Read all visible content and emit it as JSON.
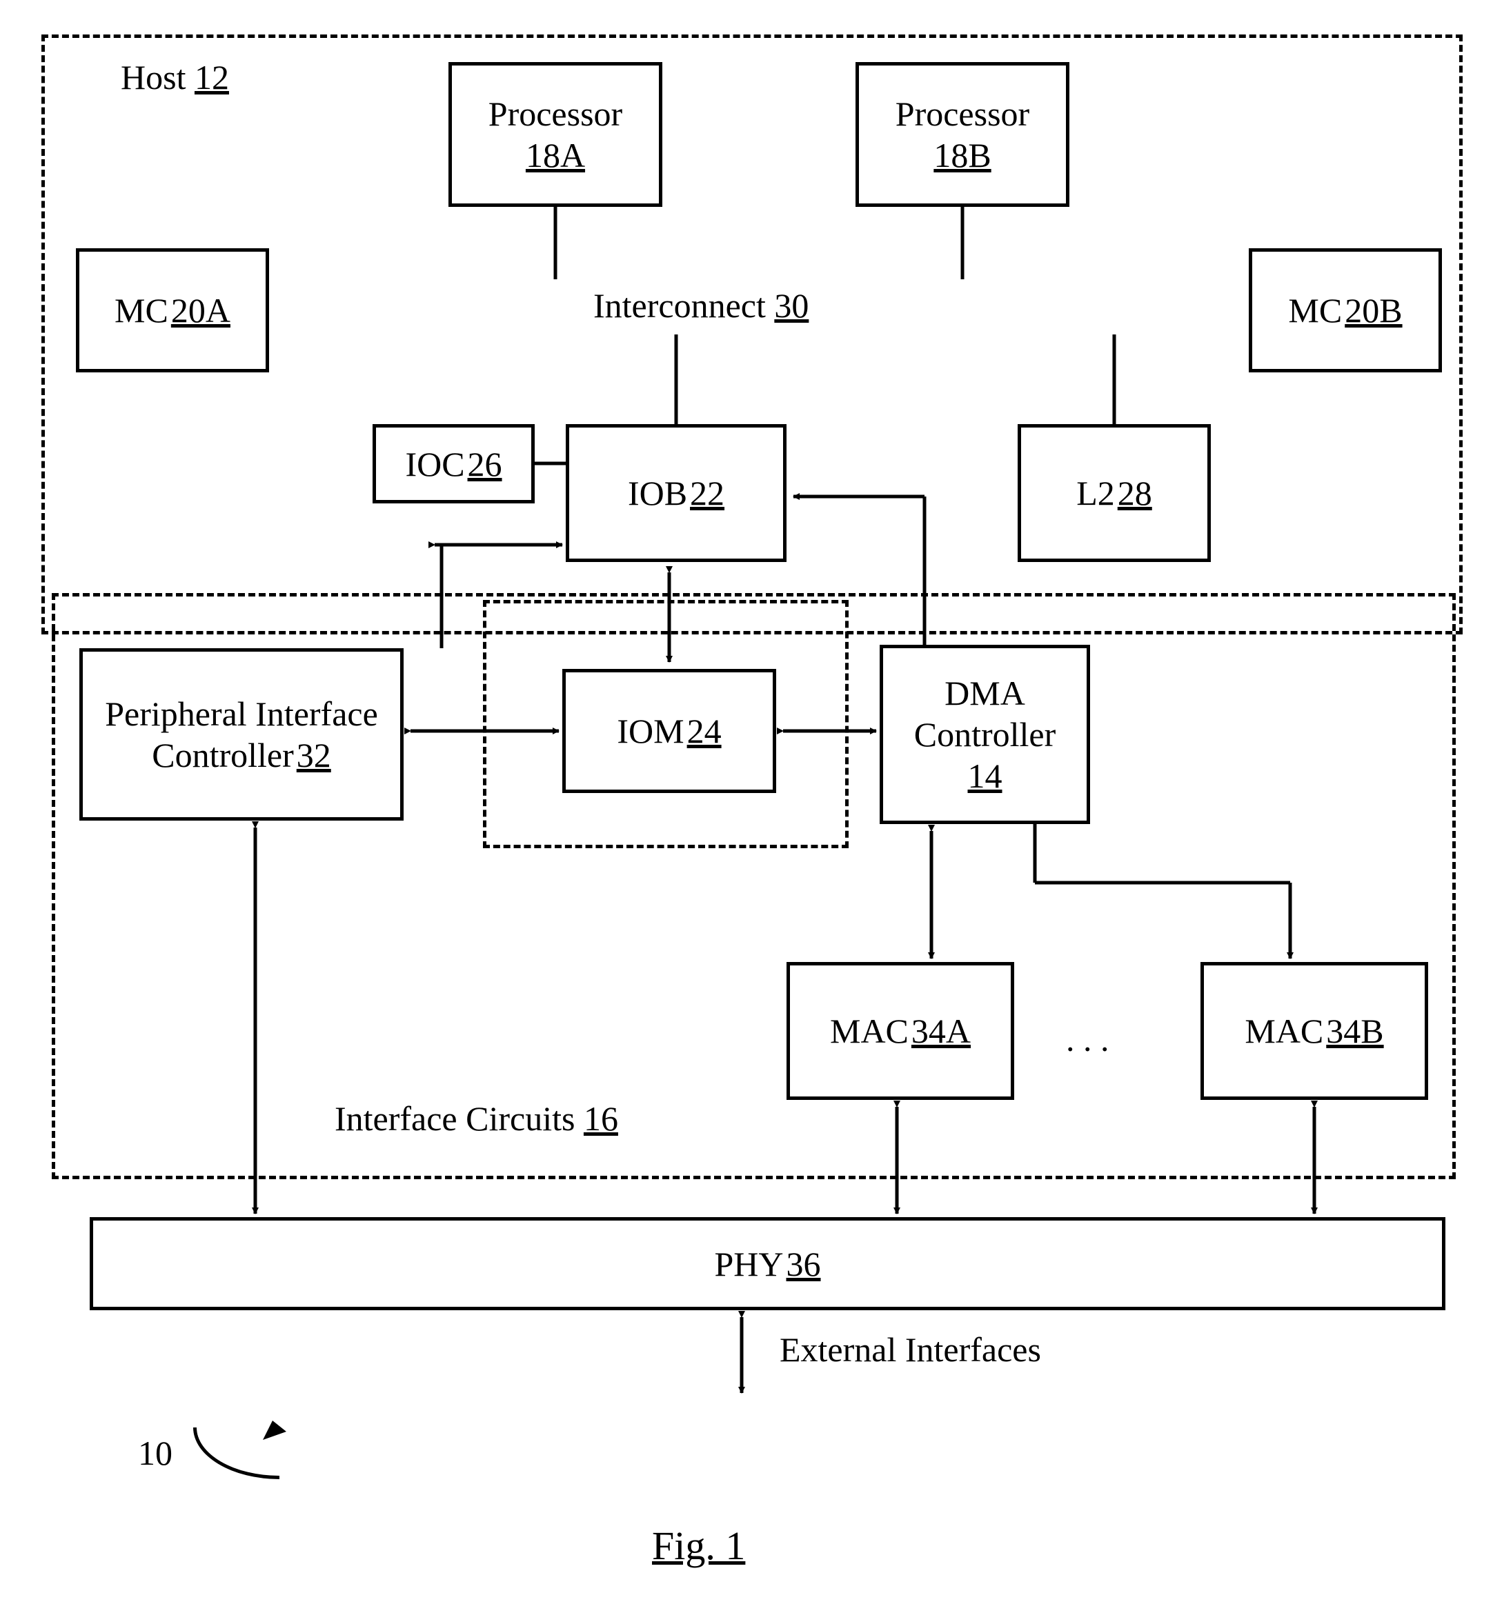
{
  "host": {
    "label": "Host",
    "ref": "12"
  },
  "procA": {
    "label": "Processor",
    "ref": "18A"
  },
  "procB": {
    "label": "Processor",
    "ref": "18B"
  },
  "mcA": {
    "label": "MC",
    "ref": "20A"
  },
  "mcB": {
    "label": "MC",
    "ref": "20B"
  },
  "interconnect": {
    "label": "Interconnect",
    "ref": "30"
  },
  "ioc": {
    "label": "IOC",
    "ref": "26"
  },
  "iob": {
    "label": "IOB",
    "ref": "22"
  },
  "iom": {
    "label": "IOM",
    "ref": "24"
  },
  "l2": {
    "label": "L2",
    "ref": "28"
  },
  "pic": {
    "label1": "Peripheral Interface",
    "label2": "Controller",
    "ref": "32"
  },
  "dma": {
    "label1": "DMA",
    "label2": "Controller",
    "ref": "14"
  },
  "macA": {
    "label": "MAC",
    "ref": "34A"
  },
  "macB": {
    "label": "MAC",
    "ref": "34B"
  },
  "macDots": ". . .",
  "ifc": {
    "label": "Interface Circuits",
    "ref": "16"
  },
  "phy": {
    "label": "PHY",
    "ref": "36"
  },
  "ext": "External Interfaces",
  "sysref": "10",
  "fig": "Fig. 1"
}
